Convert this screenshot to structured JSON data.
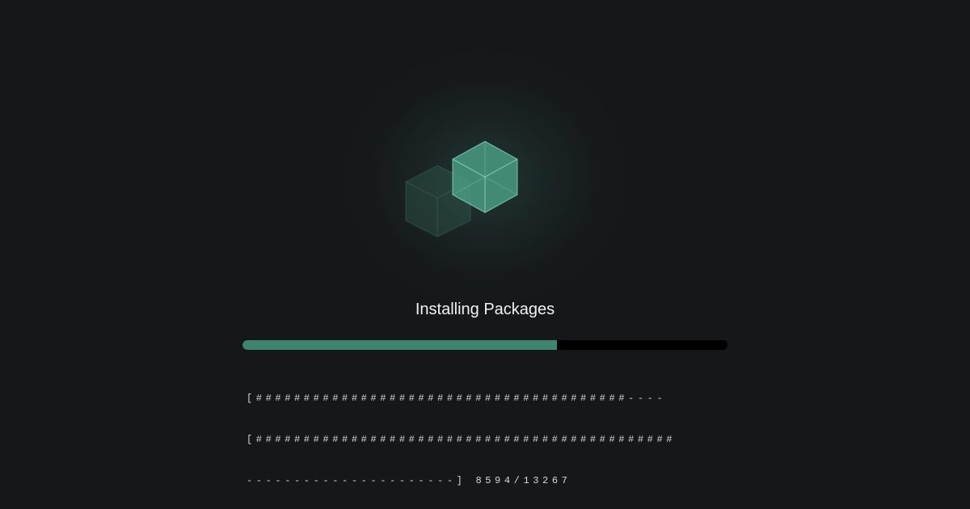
{
  "installer": {
    "title": "Installing Packages",
    "progress": {
      "completed": 8594,
      "total": 13267
    },
    "log_lines": [
      "[#######################################----",
      "[############################################",
      "----------------------]"
    ],
    "counter_text": "8594/13267",
    "icon": "package-cubes-icon"
  },
  "colors": {
    "background": "#161719",
    "accent": "#3e8470",
    "track": "#000000"
  }
}
